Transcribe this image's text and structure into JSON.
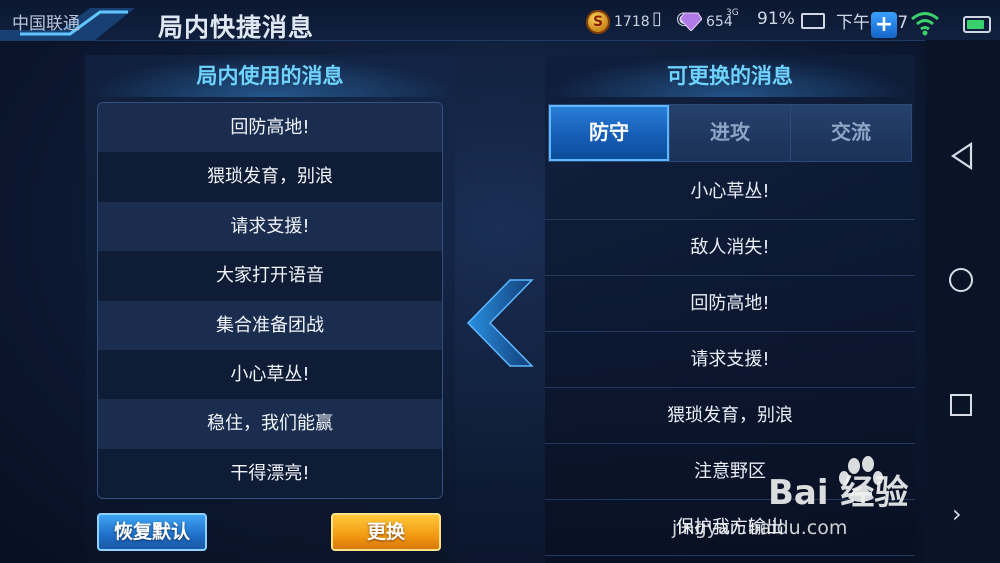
{
  "status_bar": {
    "carrier": "中国联通",
    "coin_icon_glyph": "S",
    "coin_count": "1718",
    "gem_count": "654",
    "network_label": "3G",
    "battery_percent": "91%",
    "time": "下午4:37",
    "plus_label": "+"
  },
  "page": {
    "title": "局内快捷消息"
  },
  "left_panel": {
    "header": "局内使用的消息",
    "messages": [
      "回防高地!",
      "猥琐发育，别浪",
      "请求支援!",
      "大家打开语音",
      "集合准备团战",
      "小心草丛!",
      "稳住，我们能赢",
      "干得漂亮!"
    ],
    "restore_button": "恢复默认",
    "replace_button": "更换"
  },
  "right_panel": {
    "header": "可更换的消息",
    "tabs": [
      {
        "label": "防守",
        "active": true
      },
      {
        "label": "进攻",
        "active": false
      },
      {
        "label": "交流",
        "active": false
      }
    ],
    "messages": [
      "小心草丛!",
      "敌人消失!",
      "回防高地!",
      "请求支援!",
      "猥琐发育，别浪",
      "注意野区",
      "保护我方输出"
    ]
  },
  "watermark": {
    "brand": "Bai 经验",
    "url": "jingyan.baidu.com"
  },
  "colors": {
    "header_text": "#6fd3ff",
    "active_tab": "#155eb6",
    "restore_button": "#1f6fc8",
    "replace_button": "#f39a12"
  }
}
